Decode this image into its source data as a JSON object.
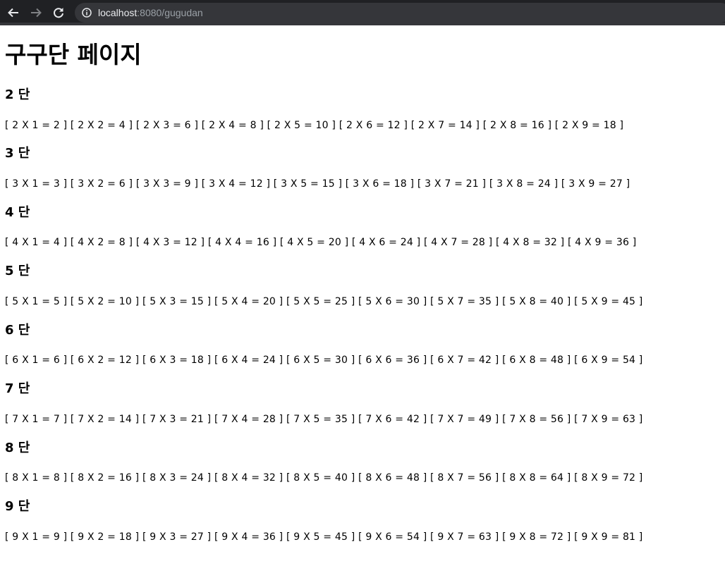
{
  "browser": {
    "url_host": "localhost",
    "url_rest": ":8080/gugudan",
    "icons": [
      "back-arrow-icon",
      "forward-arrow-icon",
      "reload-icon",
      "info-icon"
    ]
  },
  "page": {
    "title": "구구단 페이지",
    "tables": [
      {
        "heading": "2 단",
        "row": "[ 2 X 1 = 2 ] [ 2 X 2 = 4 ] [ 2 X 3 = 6 ] [ 2 X 4 = 8 ] [ 2 X 5 = 10 ] [ 2 X 6 = 12 ] [ 2 X 7 = 14 ] [ 2 X 8 = 16 ] [ 2 X 9 = 18 ]"
      },
      {
        "heading": "3 단",
        "row": "[ 3 X 1 = 3 ] [ 3 X 2 = 6 ] [ 3 X 3 = 9 ] [ 3 X 4 = 12 ] [ 3 X 5 = 15 ] [ 3 X 6 = 18 ] [ 3 X 7 = 21 ] [ 3 X 8 = 24 ] [ 3 X 9 = 27 ]"
      },
      {
        "heading": "4 단",
        "row": "[ 4 X 1 = 4 ] [ 4 X 2 = 8 ] [ 4 X 3 = 12 ] [ 4 X 4 = 16 ] [ 4 X 5 = 20 ] [ 4 X 6 = 24 ] [ 4 X 7 = 28 ] [ 4 X 8 = 32 ] [ 4 X 9 = 36 ]"
      },
      {
        "heading": "5 단",
        "row": "[ 5 X 1 = 5 ] [ 5 X 2 = 10 ] [ 5 X 3 = 15 ] [ 5 X 4 = 20 ] [ 5 X 5 = 25 ] [ 5 X 6 = 30 ] [ 5 X 7 = 35 ] [ 5 X 8 = 40 ] [ 5 X 9 = 45 ]"
      },
      {
        "heading": "6 단",
        "row": "[ 6 X 1 = 6 ] [ 6 X 2 = 12 ] [ 6 X 3 = 18 ] [ 6 X 4 = 24 ] [ 6 X 5 = 30 ] [ 6 X 6 = 36 ] [ 6 X 7 = 42 ] [ 6 X 8 = 48 ] [ 6 X 9 = 54 ]"
      },
      {
        "heading": "7 단",
        "row": "[ 7 X 1 = 7 ] [ 7 X 2 = 14 ] [ 7 X 3 = 21 ] [ 7 X 4 = 28 ] [ 7 X 5 = 35 ] [ 7 X 6 = 42 ] [ 7 X 7 = 49 ] [ 7 X 8 = 56 ] [ 7 X 9 = 63 ]"
      },
      {
        "heading": "8 단",
        "row": "[ 8 X 1 = 8 ] [ 8 X 2 = 16 ] [ 8 X 3 = 24 ] [ 8 X 4 = 32 ] [ 8 X 5 = 40 ] [ 8 X 6 = 48 ] [ 8 X 7 = 56 ] [ 8 X 8 = 64 ] [ 8 X 9 = 72 ]"
      },
      {
        "heading": "9 단",
        "row": "[ 9 X 1 = 9 ] [ 9 X 2 = 18 ] [ 9 X 3 = 27 ] [ 9 X 4 = 36 ] [ 9 X 5 = 45 ] [ 9 X 6 = 54 ] [ 9 X 7 = 63 ] [ 9 X 8 = 72 ] [ 9 X 9 = 81 ]"
      }
    ]
  }
}
